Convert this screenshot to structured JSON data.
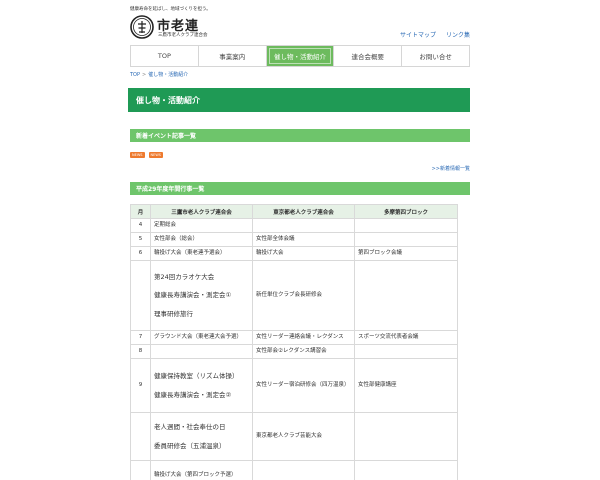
{
  "header": {
    "tagline": "健康寿命を延ばし、地域づくりを担う。",
    "logo_text": "市老連",
    "logo_sub": "三鷹市老人クラブ連合会",
    "toplinks": [
      "サイトマップ",
      "リンク集"
    ]
  },
  "nav": {
    "items": [
      "TOP",
      "事業案内",
      "催し物・活動紹介",
      "連合会概要",
      "お問い合せ"
    ],
    "active_index": 2
  },
  "breadcrumb": [
    "TOP",
    "催し物・活動紹介"
  ],
  "page_title": "催し物・活動紹介",
  "sections": {
    "news_title": "新着イベント記事一覧",
    "tags": [
      "NEWS",
      "NEWS"
    ],
    "more_link": ">>新着情報一覧",
    "schedule_title": "平成29年度年間行事一覧"
  },
  "table": {
    "headers": [
      "月",
      "三鷹市老人クラブ連合会",
      "東京都老人クラブ連合会",
      "多摩第四ブロック"
    ],
    "rows": [
      {
        "month": "4",
        "mitaka": [
          "定期総会"
        ],
        "tokyo": "",
        "tama": ""
      },
      {
        "month": "5",
        "mitaka": [
          "女性部会（総会）"
        ],
        "tokyo": "女性部全体会議",
        "tama": ""
      },
      {
        "month": "6",
        "mitaka": [
          "輪投げ大会（東老連予選会）"
        ],
        "tokyo": "輪投げ大会",
        "tama": "第四ブロック会議"
      },
      {
        "month": "",
        "mitaka": [
          "第24回カラオケ大会",
          "健康長寿講演会・測定会①",
          "理事研修旅行"
        ],
        "tokyo": "新任単位クラブ会長研修会",
        "tama": "",
        "big": true
      },
      {
        "month": "7",
        "mitaka": [
          "グラウンド大会（東老連大会予選）"
        ],
        "tokyo": "女性リーダー連絡会議・レクダンス",
        "tama": "スポーツ交流代表者会議"
      },
      {
        "month": "8",
        "mitaka": [
          ""
        ],
        "tokyo": "女性部会②レクダンス講習会",
        "tama": ""
      },
      {
        "month": "9",
        "mitaka": [
          "健康保持教室（リズム体操）",
          "健康長寿講演会・測定会②"
        ],
        "tokyo": "女性リーダー宿泊研修会（四万温泉）",
        "tama": "女性部健康講座",
        "big": true
      },
      {
        "month": "",
        "mitaka": [
          "老人週間・社会奉仕の日",
          "委員研修会（五浦温泉）"
        ],
        "tokyo": "東京都老人クラブ芸能大会",
        "tama": "",
        "big": true
      },
      {
        "month": "",
        "mitaka": [
          "輪投げ大会（第四ブロック予選）"
        ],
        "tokyo": "",
        "tama": ""
      }
    ]
  }
}
